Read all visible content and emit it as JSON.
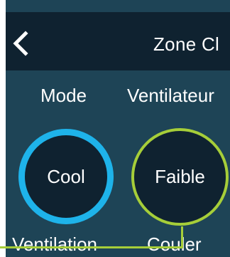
{
  "header": {
    "back_icon": "chevron-left-icon",
    "title": "Zone Cl"
  },
  "controls": {
    "mode": {
      "label": "Mode",
      "value": "Cool",
      "ring_color": "#1eb3ea"
    },
    "fan": {
      "label": "Ventilateur",
      "value": "Faible",
      "ring_color": "#a6ce39"
    }
  },
  "bottom_labels": {
    "left": "Ventilation",
    "right": "Couler"
  },
  "colors": {
    "header_bg": "#0f2230",
    "panel_bg": "#1e4456",
    "callout": "#a6ce39"
  }
}
